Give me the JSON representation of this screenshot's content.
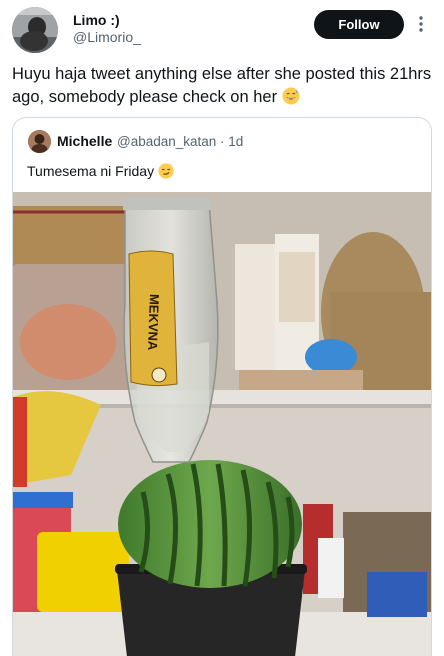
{
  "tweet": {
    "author": {
      "display_name": "Limo :)",
      "handle": "@Limorio_"
    },
    "follow_label": "Follow",
    "text": "Huyu haja tweet anything else after she posted this 21hrs ago, somebody please check on her",
    "icons": {
      "more": "more-vertical-icon",
      "emoji": "sweat-smile-emoji"
    }
  },
  "quote": {
    "author": {
      "display_name": "Michelle",
      "handle": "@abadan_katan",
      "time": "1d"
    },
    "meta": "@abadan_katan · 1d",
    "text": "Tumesema ni Friday",
    "icons": {
      "emoji": "smirk-emoji"
    },
    "photo_label_text": "MEKVNA"
  },
  "colors": {
    "follow_bg": "#0f1419",
    "secondary_text": "#536471",
    "border": "#cfd9de"
  }
}
